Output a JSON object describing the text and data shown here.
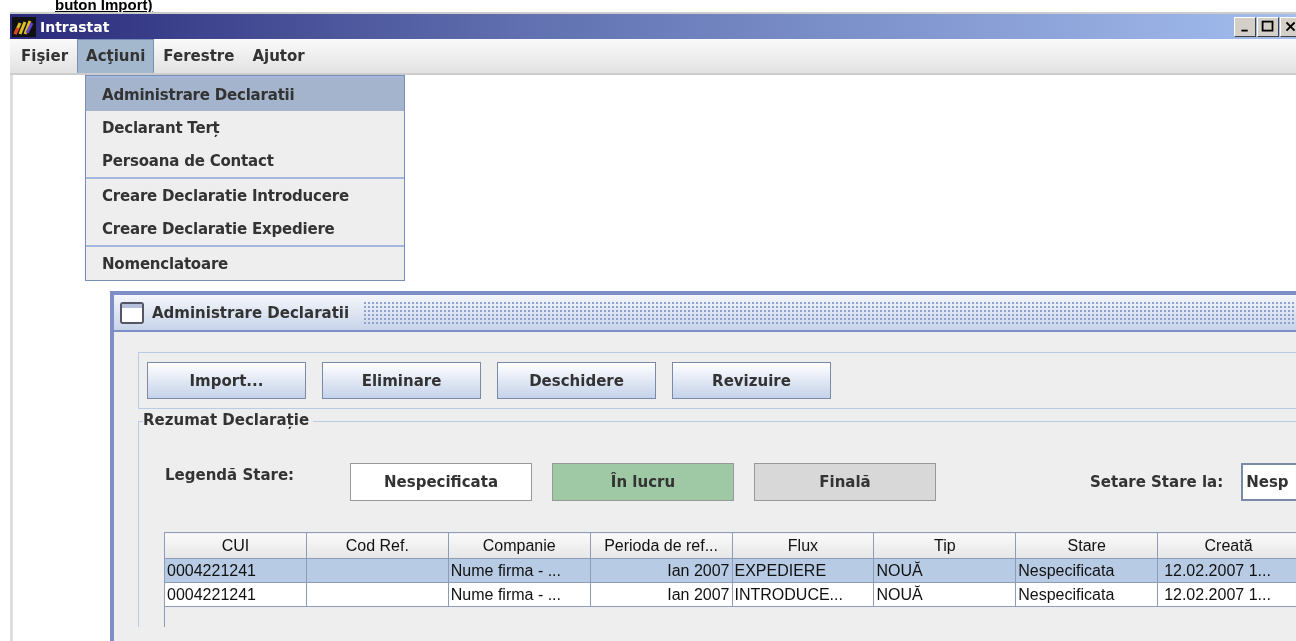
{
  "caption": "buton Import)",
  "window": {
    "title": "Intrastat"
  },
  "menu_bar": [
    {
      "label": "Fişier",
      "selected": false
    },
    {
      "label": "Acţiuni",
      "selected": true
    },
    {
      "label": "Ferestre",
      "selected": false
    },
    {
      "label": "Ajutor",
      "selected": false
    }
  ],
  "dropdown": {
    "groups": [
      [
        {
          "label": "Administrare Declaratii",
          "selected": true
        },
        {
          "label": "Declarant Terț",
          "selected": false
        },
        {
          "label": "Persoana de Contact",
          "selected": false
        }
      ],
      [
        {
          "label": "Creare Declaratie Introducere",
          "selected": false
        },
        {
          "label": "Creare Declaratie Expediere",
          "selected": false
        }
      ],
      [
        {
          "label": "Nomenclatoare",
          "selected": false
        }
      ]
    ]
  },
  "internal_window": {
    "title": "Administrare Declaratii",
    "toolbar": [
      "Import...",
      "Eliminare",
      "Deschidere",
      "Revizuire"
    ],
    "group_title": "Rezumat Declarație",
    "legend_label": "Legendă Stare:",
    "legend": [
      {
        "label": "Nespecificata",
        "color": "#ffffff"
      },
      {
        "label": "În lucru",
        "color": "#9fc8a5"
      },
      {
        "label": "Finală",
        "color": "#d8d8d8"
      }
    ],
    "set_state_label": "Setare Stare la:",
    "set_state_value": "Nesp",
    "table": {
      "columns": [
        "CUI",
        "Cod Ref.",
        "Companie",
        "Perioda de ref...",
        "Flux",
        "Tip",
        "Stare",
        "Creată"
      ],
      "rows": [
        {
          "selected": true,
          "cells": [
            "0004221241",
            "",
            "Nume firma - ...",
            "Ian 2007",
            "EXPEDIERE",
            "NOUĂ",
            "Nespecificata",
            "12.02.2007 1..."
          ]
        },
        {
          "selected": false,
          "cells": [
            "0004221241",
            "",
            "Nume firma - ...",
            "Ian 2007",
            "INTRODUCE...",
            "NOUĂ",
            "Nespecificata",
            "12.02.2007 1..."
          ]
        }
      ]
    }
  }
}
